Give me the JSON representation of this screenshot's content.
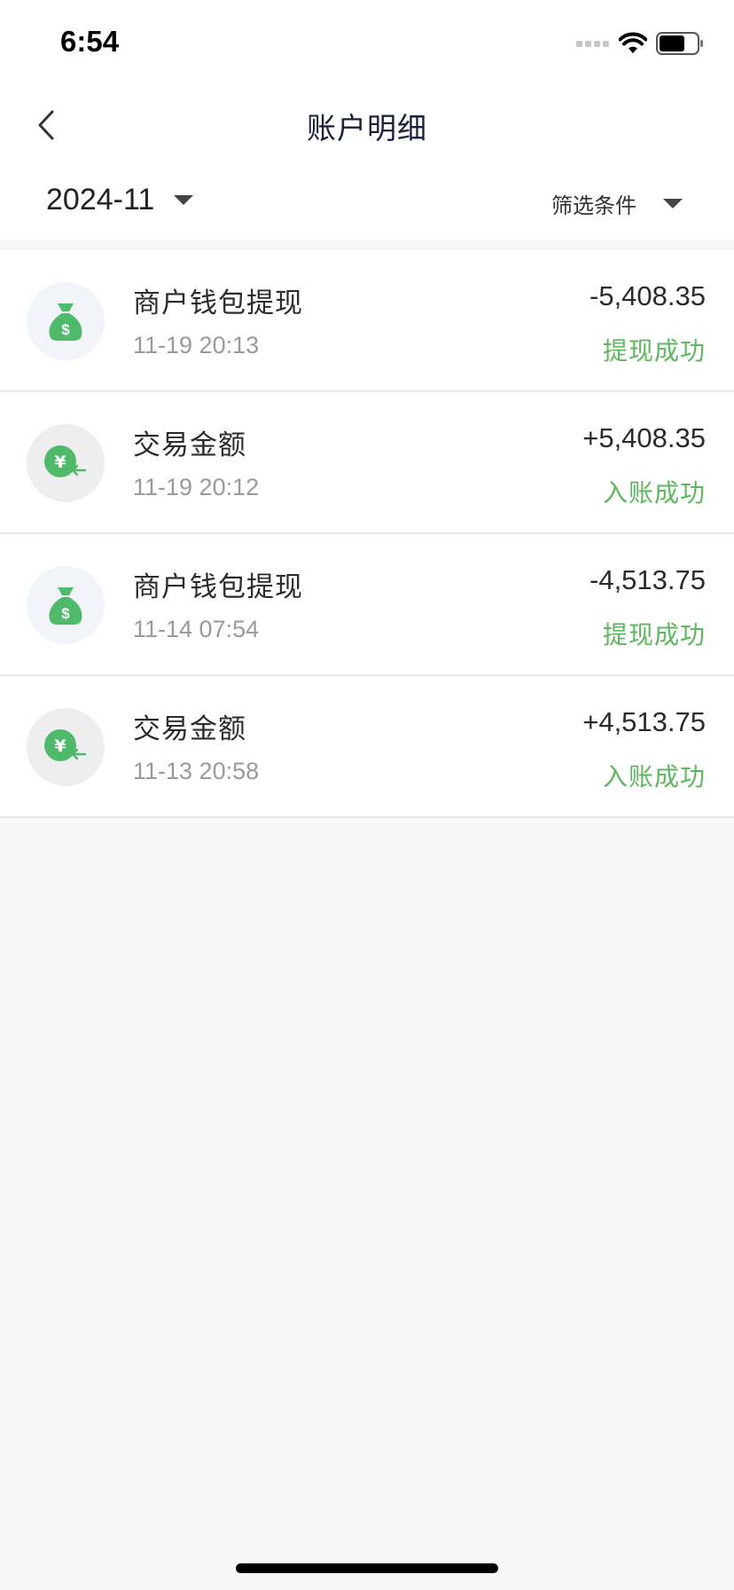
{
  "status_bar": {
    "time": "6:54"
  },
  "nav": {
    "title": "账户明细"
  },
  "filter": {
    "month": "2024-11",
    "filter_label": "筛选条件"
  },
  "colors": {
    "success": "#5cb85c",
    "icon_green": "#4fba6a"
  },
  "transactions": [
    {
      "icon": "money-bag-icon",
      "title": "商户钱包提现",
      "time": "11-19 20:13",
      "amount": "-5,408.35",
      "status": "提现成功"
    },
    {
      "icon": "yen-incoming-icon",
      "title": "交易金额",
      "time": "11-19 20:12",
      "amount": "+5,408.35",
      "status": "入账成功"
    },
    {
      "icon": "money-bag-icon",
      "title": "商户钱包提现",
      "time": "11-14 07:54",
      "amount": "-4,513.75",
      "status": "提现成功"
    },
    {
      "icon": "yen-incoming-icon",
      "title": "交易金额",
      "time": "11-13 20:58",
      "amount": "+4,513.75",
      "status": "入账成功"
    }
  ]
}
